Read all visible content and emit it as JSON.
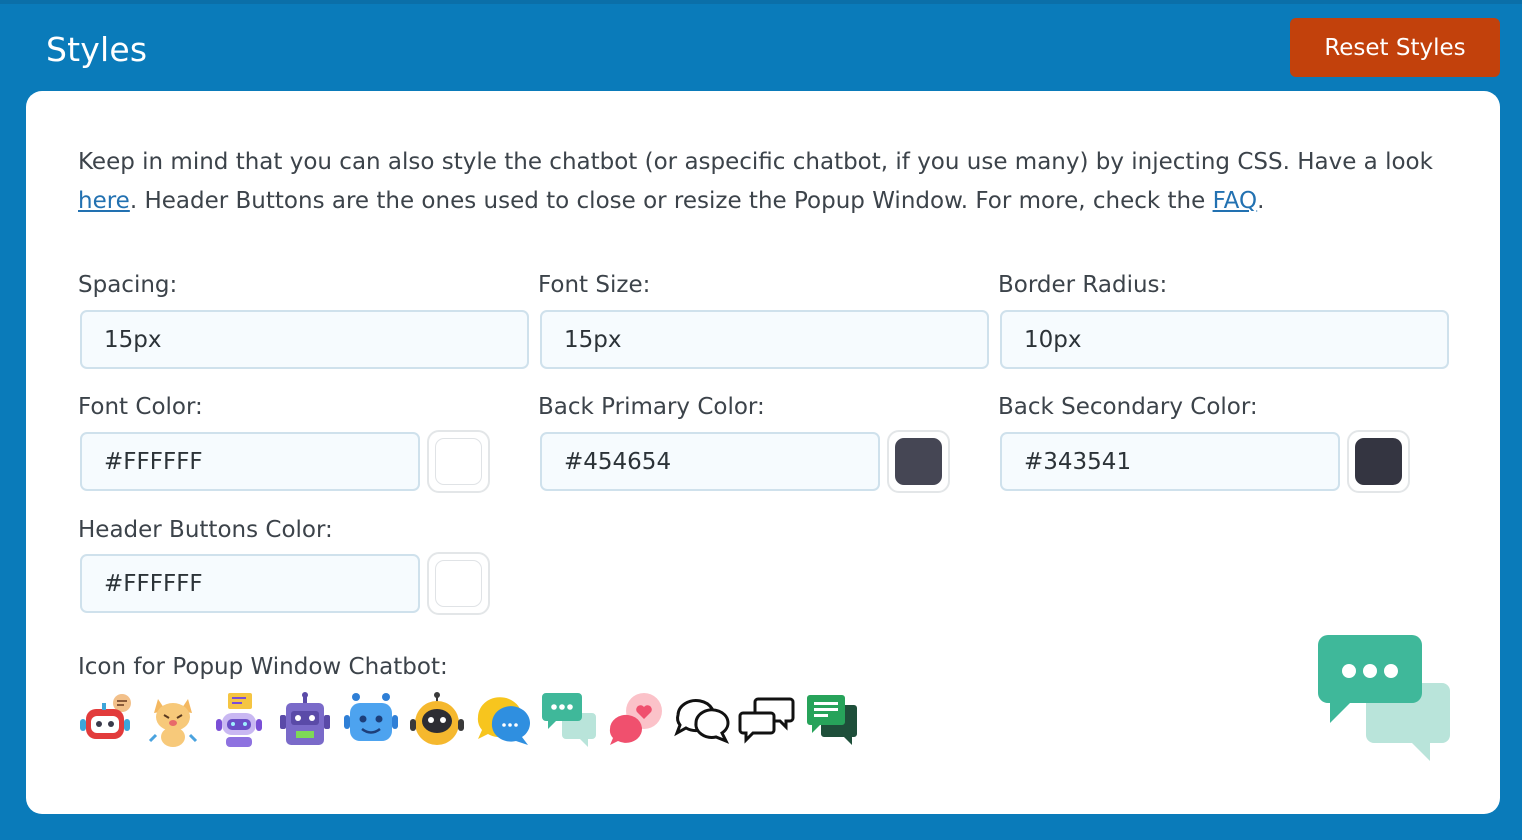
{
  "header": {
    "title": "Styles",
    "reset_label": "Reset Styles"
  },
  "intro": {
    "text_1": "Keep in mind that you can also style the chatbot (or aspecific chatbot, if you use many) by injecting CSS. Have a look ",
    "link_here": "here",
    "text_2": ". Header Buttons are the ones used to close or resize the Popup Window. For more, check the ",
    "link_faq": "FAQ",
    "text_3": "."
  },
  "fields": {
    "spacing": {
      "label": "Spacing:",
      "value": "15px"
    },
    "font_size": {
      "label": "Font Size:",
      "value": "15px"
    },
    "border_radius": {
      "label": "Border Radius:",
      "value": "10px"
    },
    "font_color": {
      "label": "Font Color:",
      "value": "#FFFFFF"
    },
    "back_primary_color": {
      "label": "Back Primary Color:",
      "value": "#454654"
    },
    "back_secondary_color": {
      "label": "Back Secondary Color:",
      "value": "#343541"
    },
    "header_buttons_color": {
      "label": "Header Buttons Color:",
      "value": "#FFFFFF"
    }
  },
  "icons": {
    "label": "Icon for Popup Window Chatbot:",
    "options": [
      "robot-red-icon",
      "cat-icon",
      "robot-purple-icon",
      "robot-box-icon",
      "robot-blue-icon",
      "robot-yellow-icon",
      "chat-bubbles-yellow-blue-icon",
      "chat-bubbles-teal-icon",
      "chat-heart-icon",
      "chat-outline-round-icon",
      "chat-outline-square-icon",
      "chat-green-lines-icon"
    ],
    "selected_preview": "chat-bubbles-teal-icon"
  },
  "colors": {
    "background": "#0a7bba",
    "reset_button": "#c2410c",
    "link": "#2271b1",
    "input_bg": "#f6fbfe",
    "input_border": "#cfe1ec"
  }
}
